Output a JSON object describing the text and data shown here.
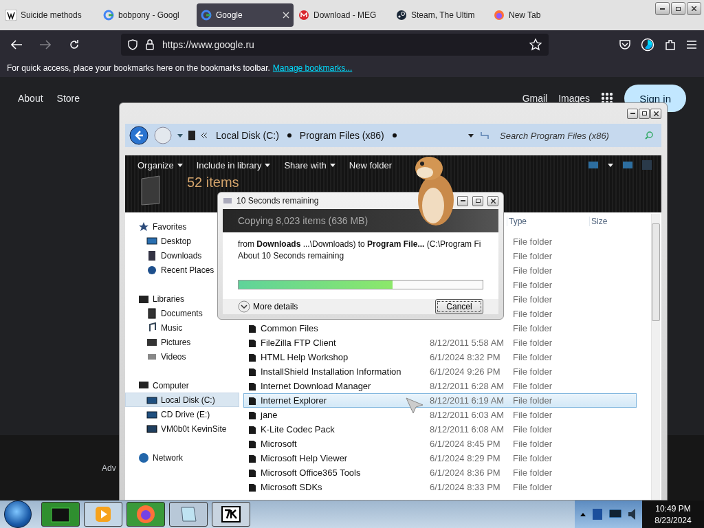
{
  "browser": {
    "tabs": [
      {
        "label": "Suicide methods",
        "selected": false,
        "kind": "wiki"
      },
      {
        "label": "bobpony - Googl",
        "selected": false,
        "kind": "google"
      },
      {
        "label": "Google",
        "selected": true,
        "kind": "google"
      },
      {
        "label": "Download - MEG",
        "selected": false,
        "kind": "mega"
      },
      {
        "label": "Steam, The Ultim",
        "selected": false,
        "kind": "steam"
      },
      {
        "label": "New Tab",
        "selected": false,
        "kind": "firefox"
      }
    ],
    "address": "https://www.google.ru",
    "forward_disabled": true,
    "bookmarks_hint": "For quick access, place your bookmarks here on the bookmarks toolbar.",
    "bookmarks_link": "Manage bookmarks..."
  },
  "google": {
    "left_links": [
      "About",
      "Store"
    ],
    "right_links": [
      "Gmail",
      "Images"
    ],
    "sign_in": "Sign in",
    "footer_text": "Adv"
  },
  "explorer": {
    "breadcrumbs": [
      "Local Disk (C:)",
      "Program Files (x86)"
    ],
    "search_placeholder": "Search Program Files (x86)",
    "toolbar": [
      {
        "label": "Organize",
        "menu": true
      },
      {
        "label": "Include in library",
        "menu": true
      },
      {
        "label": "Share with",
        "menu": true
      },
      {
        "label": "New folder",
        "menu": false
      }
    ],
    "item_count": "52 items",
    "nav": [
      {
        "label": "Favorites",
        "kind": "favorites",
        "selected": false,
        "children": [
          {
            "label": "Desktop",
            "kind": "desktop",
            "selected": false
          },
          {
            "label": "Downloads",
            "kind": "downloads",
            "selected": false
          },
          {
            "label": "Recent Places",
            "kind": "recent",
            "selected": false
          }
        ]
      },
      {
        "label": "Libraries",
        "kind": "library",
        "selected": false,
        "children": [
          {
            "label": "Documents",
            "kind": "documents",
            "selected": false
          },
          {
            "label": "Music",
            "kind": "music",
            "selected": false
          },
          {
            "label": "Pictures",
            "kind": "pictures",
            "selected": false
          },
          {
            "label": "Videos",
            "kind": "videos",
            "selected": false
          }
        ]
      },
      {
        "label": "Computer",
        "kind": "computer",
        "selected": false,
        "children": [
          {
            "label": "Local Disk (C:)",
            "kind": "drive",
            "selected": true
          },
          {
            "label": "CD Drive (E:)",
            "kind": "drive",
            "selected": false
          },
          {
            "label": "VM0b0t KevinSite",
            "kind": "netdrive",
            "selected": false
          }
        ]
      },
      {
        "label": "Network",
        "kind": "network",
        "selected": false
      }
    ],
    "columns": [
      "Type",
      "Size"
    ],
    "rows": [
      {
        "type": "File folder",
        "selected": false
      },
      {
        "type": "File folder",
        "selected": false
      },
      {
        "type": "File folder",
        "selected": false
      },
      {
        "type": "File folder",
        "selected": false
      },
      {
        "type": "File folder",
        "selected": false
      },
      {
        "type": "File folder",
        "selected": false
      },
      {
        "name": "Common Files",
        "type": "File folder",
        "selected": false
      },
      {
        "name": "FileZilla FTP Client",
        "date": "8/12/2011 5:58 AM",
        "type": "File folder",
        "selected": false
      },
      {
        "name": "HTML Help Workshop",
        "date": "6/1/2024 8:32 PM",
        "type": "File folder",
        "selected": false
      },
      {
        "name": "InstallShield Installation Information",
        "date": "6/1/2024 9:26 PM",
        "type": "File folder",
        "selected": false
      },
      {
        "name": "Internet Download Manager",
        "date": "8/12/2011 6:28 AM",
        "type": "File folder",
        "selected": false
      },
      {
        "name": "Internet Explorer",
        "date": "8/12/2011 6:19 AM",
        "type": "File folder",
        "selected": true
      },
      {
        "name": "jane",
        "date": "8/12/2011 6:03 AM",
        "type": "File folder",
        "selected": false
      },
      {
        "name": "K-Lite Codec Pack",
        "date": "8/12/2011 6:08 AM",
        "type": "File folder",
        "selected": false
      },
      {
        "name": "Microsoft",
        "date": "6/1/2024 8:45 PM",
        "type": "File folder",
        "selected": false
      },
      {
        "name": "Microsoft Help Viewer",
        "date": "6/1/2024 8:29 PM",
        "type": "File folder",
        "selected": false
      },
      {
        "name": "Microsoft Office365 Tools",
        "date": "6/1/2024 8:36 PM",
        "type": "File folder",
        "selected": false
      },
      {
        "name": "Microsoft SDKs",
        "date": "6/1/2024 8:33 PM",
        "type": "File folder",
        "selected": false
      }
    ]
  },
  "copy_dialog": {
    "title": "10 Seconds remaining",
    "heading": "Copying 8,023 items (636 MB)",
    "from_line": "from **Downloads** ...\\Downloads)  to **Program File...** (C:\\Program Fi",
    "time_line": "About 10 Seconds remaining",
    "level": 0.63,
    "details": "More details",
    "cancel": "Cancel"
  },
  "taskbar": {
    "apps": [
      {
        "kind": "terminal"
      },
      {
        "kind": "media"
      },
      {
        "kind": "firefox"
      },
      {
        "kind": "notepad"
      },
      {
        "kind": "archiver"
      }
    ],
    "time": "10:49 PM",
    "date": "8/23/2024"
  }
}
